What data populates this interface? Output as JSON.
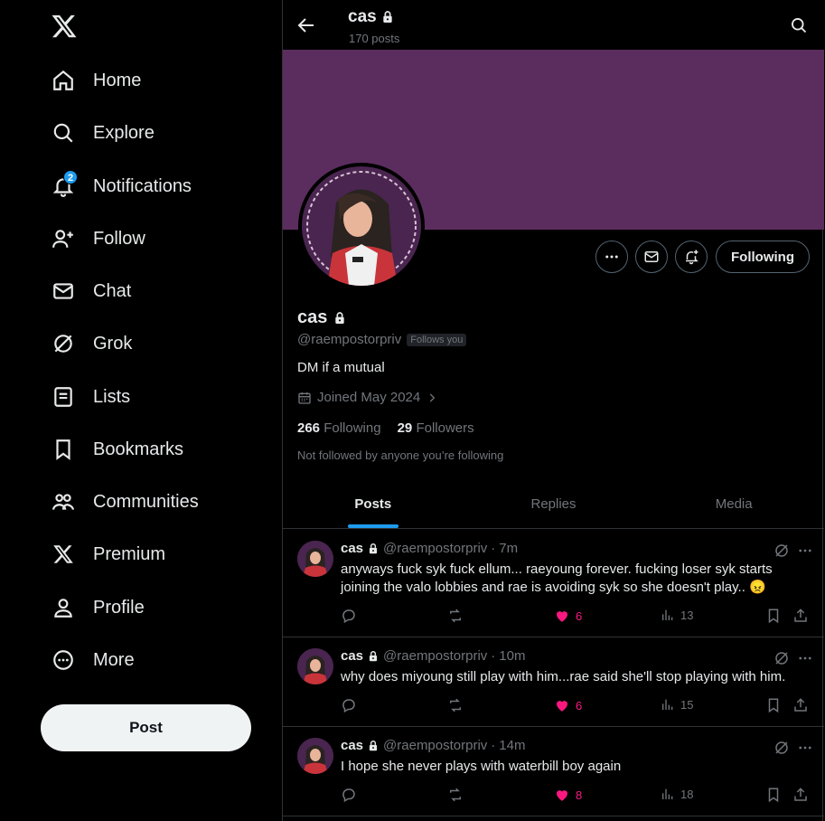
{
  "nav": {
    "items": [
      {
        "label": "Home",
        "icon": "home-icon"
      },
      {
        "label": "Explore",
        "icon": "search-icon"
      },
      {
        "label": "Notifications",
        "icon": "bell-icon",
        "badge": "2"
      },
      {
        "label": "Follow",
        "icon": "follow-icon"
      },
      {
        "label": "Chat",
        "icon": "mail-icon"
      },
      {
        "label": "Grok",
        "icon": "grok-icon"
      },
      {
        "label": "Lists",
        "icon": "lists-icon"
      },
      {
        "label": "Bookmarks",
        "icon": "bookmark-icon"
      },
      {
        "label": "Communities",
        "icon": "communities-icon"
      },
      {
        "label": "Premium",
        "icon": "x-logo-icon"
      },
      {
        "label": "Profile",
        "icon": "profile-icon"
      },
      {
        "label": "More",
        "icon": "more-circle-icon"
      }
    ],
    "post_label": "Post"
  },
  "header": {
    "name": "cas",
    "post_count": "170 posts"
  },
  "colors": {
    "banner": "#5b2d5e",
    "accent": "#1d9bf0",
    "like": "#f91880"
  },
  "profile": {
    "name": "cas",
    "handle": "@raempostorpriv",
    "follows_you": "Follows you",
    "bio": "DM if a mutual",
    "joined": "Joined May 2024",
    "following_count": "266",
    "following_label": "Following",
    "followers_count": "29",
    "followers_label": "Followers",
    "not_followed": "Not followed by anyone you’re following",
    "following_button": "Following"
  },
  "tabs": [
    {
      "label": "Posts",
      "active": true
    },
    {
      "label": "Replies",
      "active": false
    },
    {
      "label": "Media",
      "active": false
    }
  ],
  "tweets": [
    {
      "name": "cas",
      "handle": "@raempostorpriv",
      "time": "7m",
      "text": "anyways fuck syk fuck ellum... raeyoung forever. fucking loser syk starts joining the valo lobbies and rae is avoiding syk so she doesn't play.. 😠",
      "likes": "6",
      "views": "13"
    },
    {
      "name": "cas",
      "handle": "@raempostorpriv",
      "time": "10m",
      "text": "why does miyoung still play with him...rae said she'll stop playing with him.",
      "likes": "6",
      "views": "15"
    },
    {
      "name": "cas",
      "handle": "@raempostorpriv",
      "time": "14m",
      "text": "I hope she never plays with waterbill boy again",
      "likes": "8",
      "views": "18"
    }
  ]
}
